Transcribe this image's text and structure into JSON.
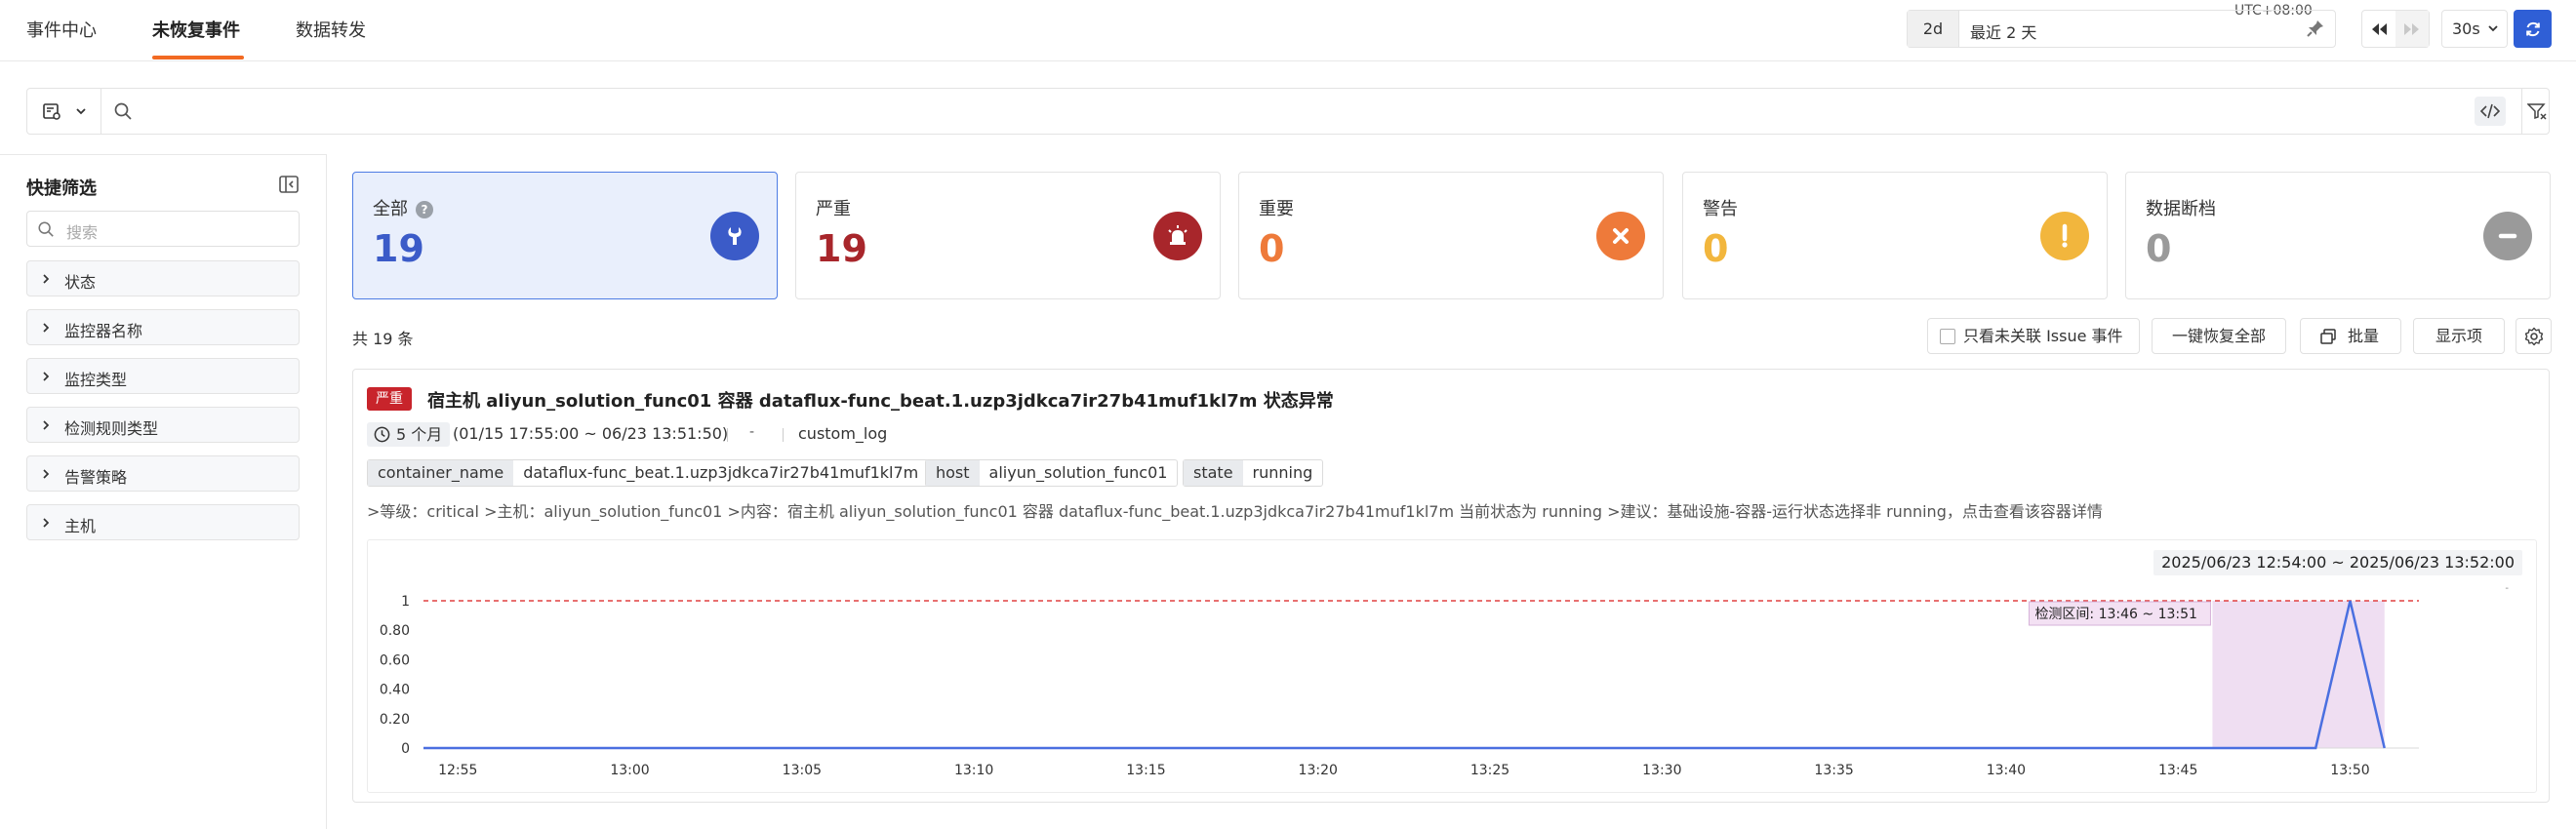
{
  "tabs": [
    {
      "label": "事件中心"
    },
    {
      "label": "未恢复事件"
    },
    {
      "label": "数据转发"
    }
  ],
  "time": {
    "timezone": "UTC+08:00",
    "quick": "2d",
    "label": "最近 2 天",
    "refresh_interval": "30s"
  },
  "sidebar": {
    "title": "快捷筛选",
    "search_placeholder": "搜索",
    "items": [
      {
        "label": "状态"
      },
      {
        "label": "监控器名称"
      },
      {
        "label": "监控类型"
      },
      {
        "label": "检测规则类型"
      },
      {
        "label": "告警策略"
      },
      {
        "label": "主机"
      }
    ]
  },
  "cards": [
    {
      "title": "全部",
      "count": "19",
      "color": "#3b5bc8",
      "icon": "wrench-icon"
    },
    {
      "title": "严重",
      "count": "19",
      "color": "#a8262b",
      "icon": "siren-icon"
    },
    {
      "title": "重要",
      "count": "0",
      "color": "#ee7a3a",
      "icon": "x-icon"
    },
    {
      "title": "警告",
      "count": "0",
      "color": "#f2b63d",
      "icon": "exclamation-icon"
    },
    {
      "title": "数据断档",
      "count": "0",
      "color": "#9a9a9a",
      "icon": "minus-icon"
    }
  ],
  "list": {
    "total": "共 19 条",
    "only_unlinked": "只看未关联 Issue 事件",
    "recover_all": "一键恢复全部",
    "batch": "批量",
    "display": "显示项"
  },
  "event": {
    "severity": "严重",
    "title": "宿主机 aliyun_solution_func01 容器 dataflux-func_beat.1.uzp3jdkca7ir27b41muf1kl7m 状态异常",
    "duration": "5 个月",
    "range": "(01/15 17:55:00 ~ 06/23 13:51:50)",
    "dash": "-",
    "source": "custom_log",
    "tags": [
      {
        "key": "container_name",
        "value": "dataflux-func_beat.1.uzp3jdkca7ir27b41muf1kl7m"
      },
      {
        "key": "host",
        "value": "aliyun_solution_func01"
      },
      {
        "key": "state",
        "value": "running"
      }
    ],
    "description": ">等级：critical >主机：aliyun_solution_func01 >内容：宿主机 aliyun_solution_func01 容器 dataflux-func_beat.1.uzp3jdkca7ir27b41muf1kl7m 当前状态为 running >建议：基础设施-容器-运行状态选择非 running，点击查看该容器详情",
    "chart_range": "2025/06/23 12:54:00 ~ 2025/06/23 13:52:00",
    "chart_dot": "-",
    "detect_label": "检测区间: 13:46 ~ 13:51"
  },
  "chart_data": {
    "type": "line",
    "x_start": "12:54",
    "x_end": "13:52",
    "xticks": [
      "12:55",
      "13:00",
      "13:05",
      "13:10",
      "13:15",
      "13:20",
      "13:25",
      "13:30",
      "13:35",
      "13:40",
      "13:45",
      "13:50"
    ],
    "yticks": [
      "0",
      "0.20",
      "0.40",
      "0.60",
      "0.80",
      "1"
    ],
    "ylim": [
      0,
      1
    ],
    "threshold": 1,
    "detect_window": [
      "13:46",
      "13:51"
    ],
    "points": [
      {
        "x": "12:54",
        "y": 0
      },
      {
        "x": "13:49",
        "y": 0
      },
      {
        "x": "13:50",
        "y": 1
      },
      {
        "x": "13:51",
        "y": 0
      }
    ],
    "line_color": "#4a6fe0",
    "threshold_color": "#e04040",
    "window_color": "#ead3ee"
  }
}
